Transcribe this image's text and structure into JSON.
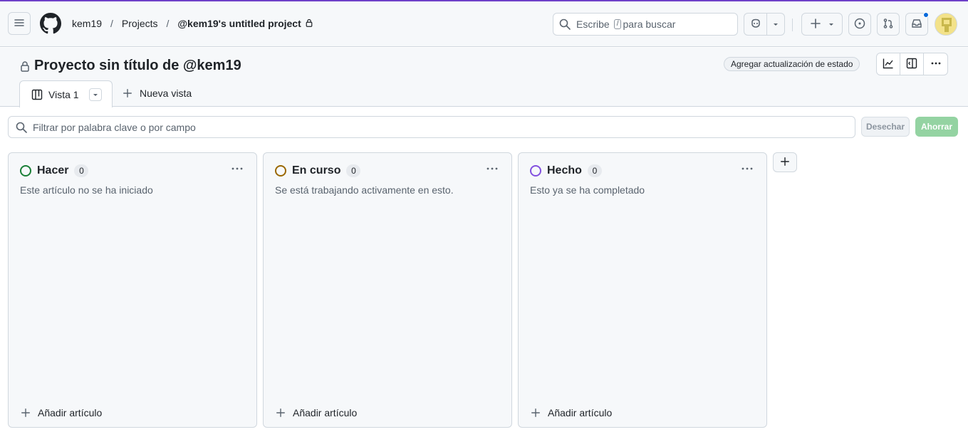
{
  "header": {
    "breadcrumb": {
      "owner": "kem19",
      "section": "Projects",
      "project": "@kem19's untitled project",
      "separator": "/"
    },
    "search": {
      "prefix": "Escribe",
      "shortcut": "/",
      "suffix": "para buscar"
    },
    "icons": [
      "menu-icon",
      "github-logo-icon",
      "search-icon",
      "copilot-icon",
      "plus-icon",
      "issues-icon",
      "pull-requests-icon",
      "inbox-icon",
      "avatar"
    ],
    "colors": {
      "accent_line": "#6e40c9",
      "notification_dot": "#0969da"
    }
  },
  "project": {
    "title": "Proyecto sin título de @kem19",
    "status_update_button": "Agregar actualización de estado"
  },
  "tabs": {
    "active_view": "Vista 1",
    "new_view": "Nueva vista"
  },
  "filter": {
    "placeholder": "Filtrar por palabra clave o por campo",
    "discard_label": "Desechar",
    "save_label": "Ahorrar",
    "save_color": "#94d3a2"
  },
  "columns": [
    {
      "name": "Hacer",
      "count": "0",
      "description": "Este artículo no se ha iniciado",
      "color": "#1a7f37",
      "add_label": "Añadir artículo"
    },
    {
      "name": "En curso",
      "count": "0",
      "description": "Se está trabajando activamente en esto.",
      "color": "#9a6700",
      "add_label": "Añadir artículo"
    },
    {
      "name": "Hecho",
      "count": "0",
      "description": "Esto ya se ha completado",
      "color": "#8250df",
      "add_label": "Añadir artículo"
    }
  ]
}
